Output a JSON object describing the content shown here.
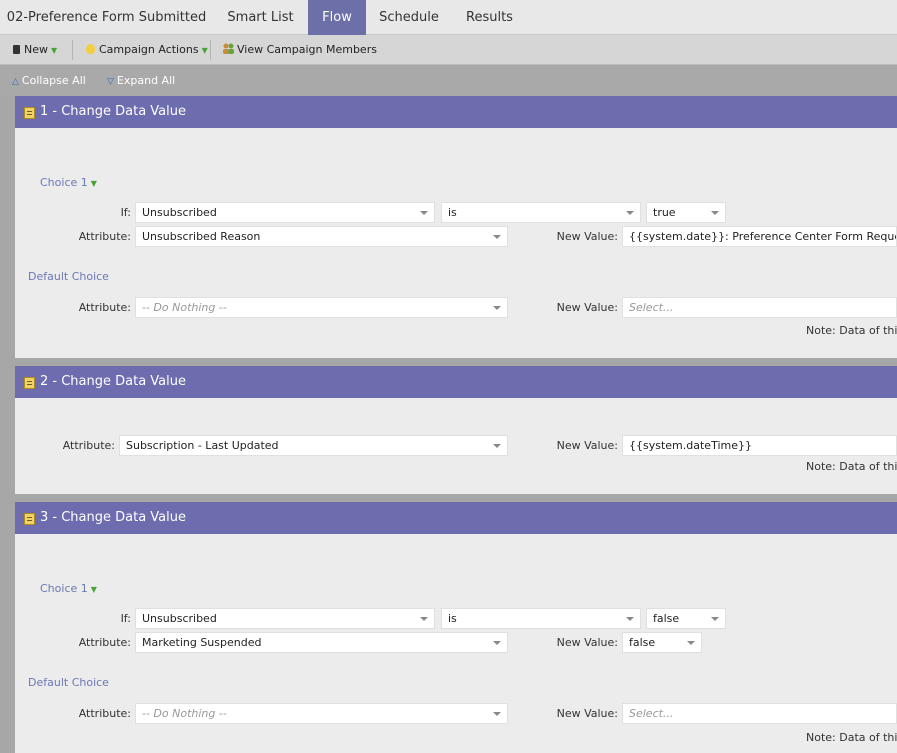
{
  "tabs": [
    {
      "label": "02-Preference Form Submitted"
    },
    {
      "label": "Smart List"
    },
    {
      "label": "Flow"
    },
    {
      "label": "Schedule"
    },
    {
      "label": "Results"
    }
  ],
  "active_tab": "Flow",
  "toolbar": {
    "new_label": "New",
    "campaign_actions_label": "Campaign Actions",
    "view_members_label": "View Campaign Members"
  },
  "subbar": {
    "collapse_label": "Collapse All",
    "expand_label": "Expand All"
  },
  "labels": {
    "if": "If:",
    "attribute": "Attribute:",
    "new_value": "New Value:",
    "default_choice": "Default Choice",
    "note": "Note: Data of this a"
  },
  "steps": [
    {
      "title": "1 - Change Data Value",
      "choice_label": "Choice 1",
      "if_field": "Unsubscribed",
      "if_operator": "is",
      "if_value": "true",
      "attribute": "Unsubscribed Reason",
      "new_value": "{{system.date}}: Preference Center Form Request",
      "default_attribute": "-- Do Nothing --",
      "default_new_value_placeholder": "Select..."
    },
    {
      "title": "2 - Change Data Value",
      "attribute": "Subscription - Last Updated",
      "new_value": "{{system.dateTime}}"
    },
    {
      "title": "3 - Change Data Value",
      "choice_label": "Choice 1",
      "if_field": "Unsubscribed",
      "if_operator": "is",
      "if_value": "false",
      "attribute": "Marketing Suspended",
      "new_value": "false",
      "default_attribute": "-- Do Nothing --",
      "default_new_value_placeholder": "Select..."
    }
  ],
  "colors": {
    "accent": "#6c6cae",
    "active_tab": "#6c6fa8",
    "choice_text": "#6b78b4"
  }
}
